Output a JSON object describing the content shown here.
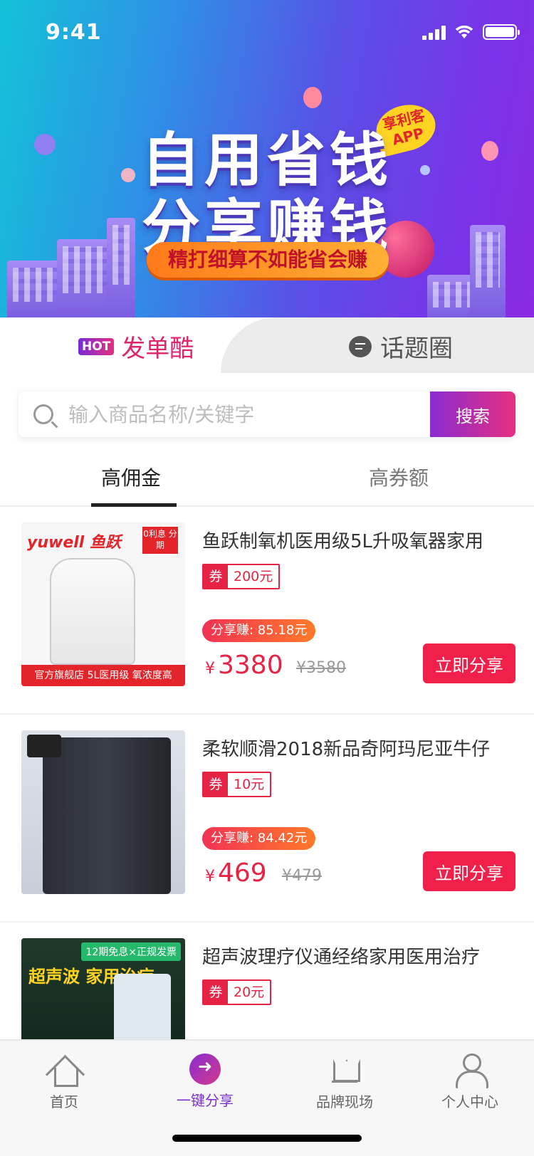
{
  "status_bar": {
    "time": "9:41"
  },
  "banner": {
    "line1": "自用省钱",
    "line2": "分享赚钱",
    "slogan": "精打细算不如能省会赚",
    "badge": "享利客 APP"
  },
  "segments": {
    "hot_badge": "HOT",
    "left_label": "发单酷",
    "right_label": "话题圈"
  },
  "search": {
    "placeholder": "输入商品名称/关键字",
    "button": "搜索"
  },
  "sort_tabs": [
    {
      "label": "高佣金",
      "active": true
    },
    {
      "label": "高券额",
      "active": false
    }
  ],
  "products": [
    {
      "title": "鱼跃制氧机医用级5L升吸氧器家用",
      "coupon_tag": "券",
      "coupon": "200元",
      "earn": "分享赚: 85.18元",
      "currency": "¥",
      "price": "3380",
      "original_price": "¥3580",
      "share_button": "立即分享",
      "thumb_brand": "yuwell 鱼跃",
      "thumb_badge": "0利息 分期",
      "thumb_footer": "官方旗舰店 5L医用级 氧浓度高"
    },
    {
      "title": "柔软顺滑2018新品奇阿玛尼亚牛仔",
      "coupon_tag": "券",
      "coupon": "10元",
      "earn": "分享赚: 84.42元",
      "currency": "¥",
      "price": "469",
      "original_price": "¥479",
      "share_button": "立即分享"
    },
    {
      "title": "超声波理疗仪通经络家用医用治疗",
      "coupon_tag": "券",
      "coupon": "20元",
      "thumb_tag": "12期免息×正规发票",
      "thumb_text": "超声波 家用治疗"
    }
  ],
  "bottom_nav": [
    {
      "label": "首页",
      "icon": "home-icon",
      "active": false
    },
    {
      "label": "一键分享",
      "icon": "share-icon",
      "active": true
    },
    {
      "label": "品牌现场",
      "icon": "crown-icon",
      "active": false
    },
    {
      "label": "个人中心",
      "icon": "user-icon",
      "active": false
    }
  ],
  "colors": {
    "accent": "#e62345",
    "brand_purple": "#7b2fd0",
    "hot_pink": "#e0246a"
  }
}
